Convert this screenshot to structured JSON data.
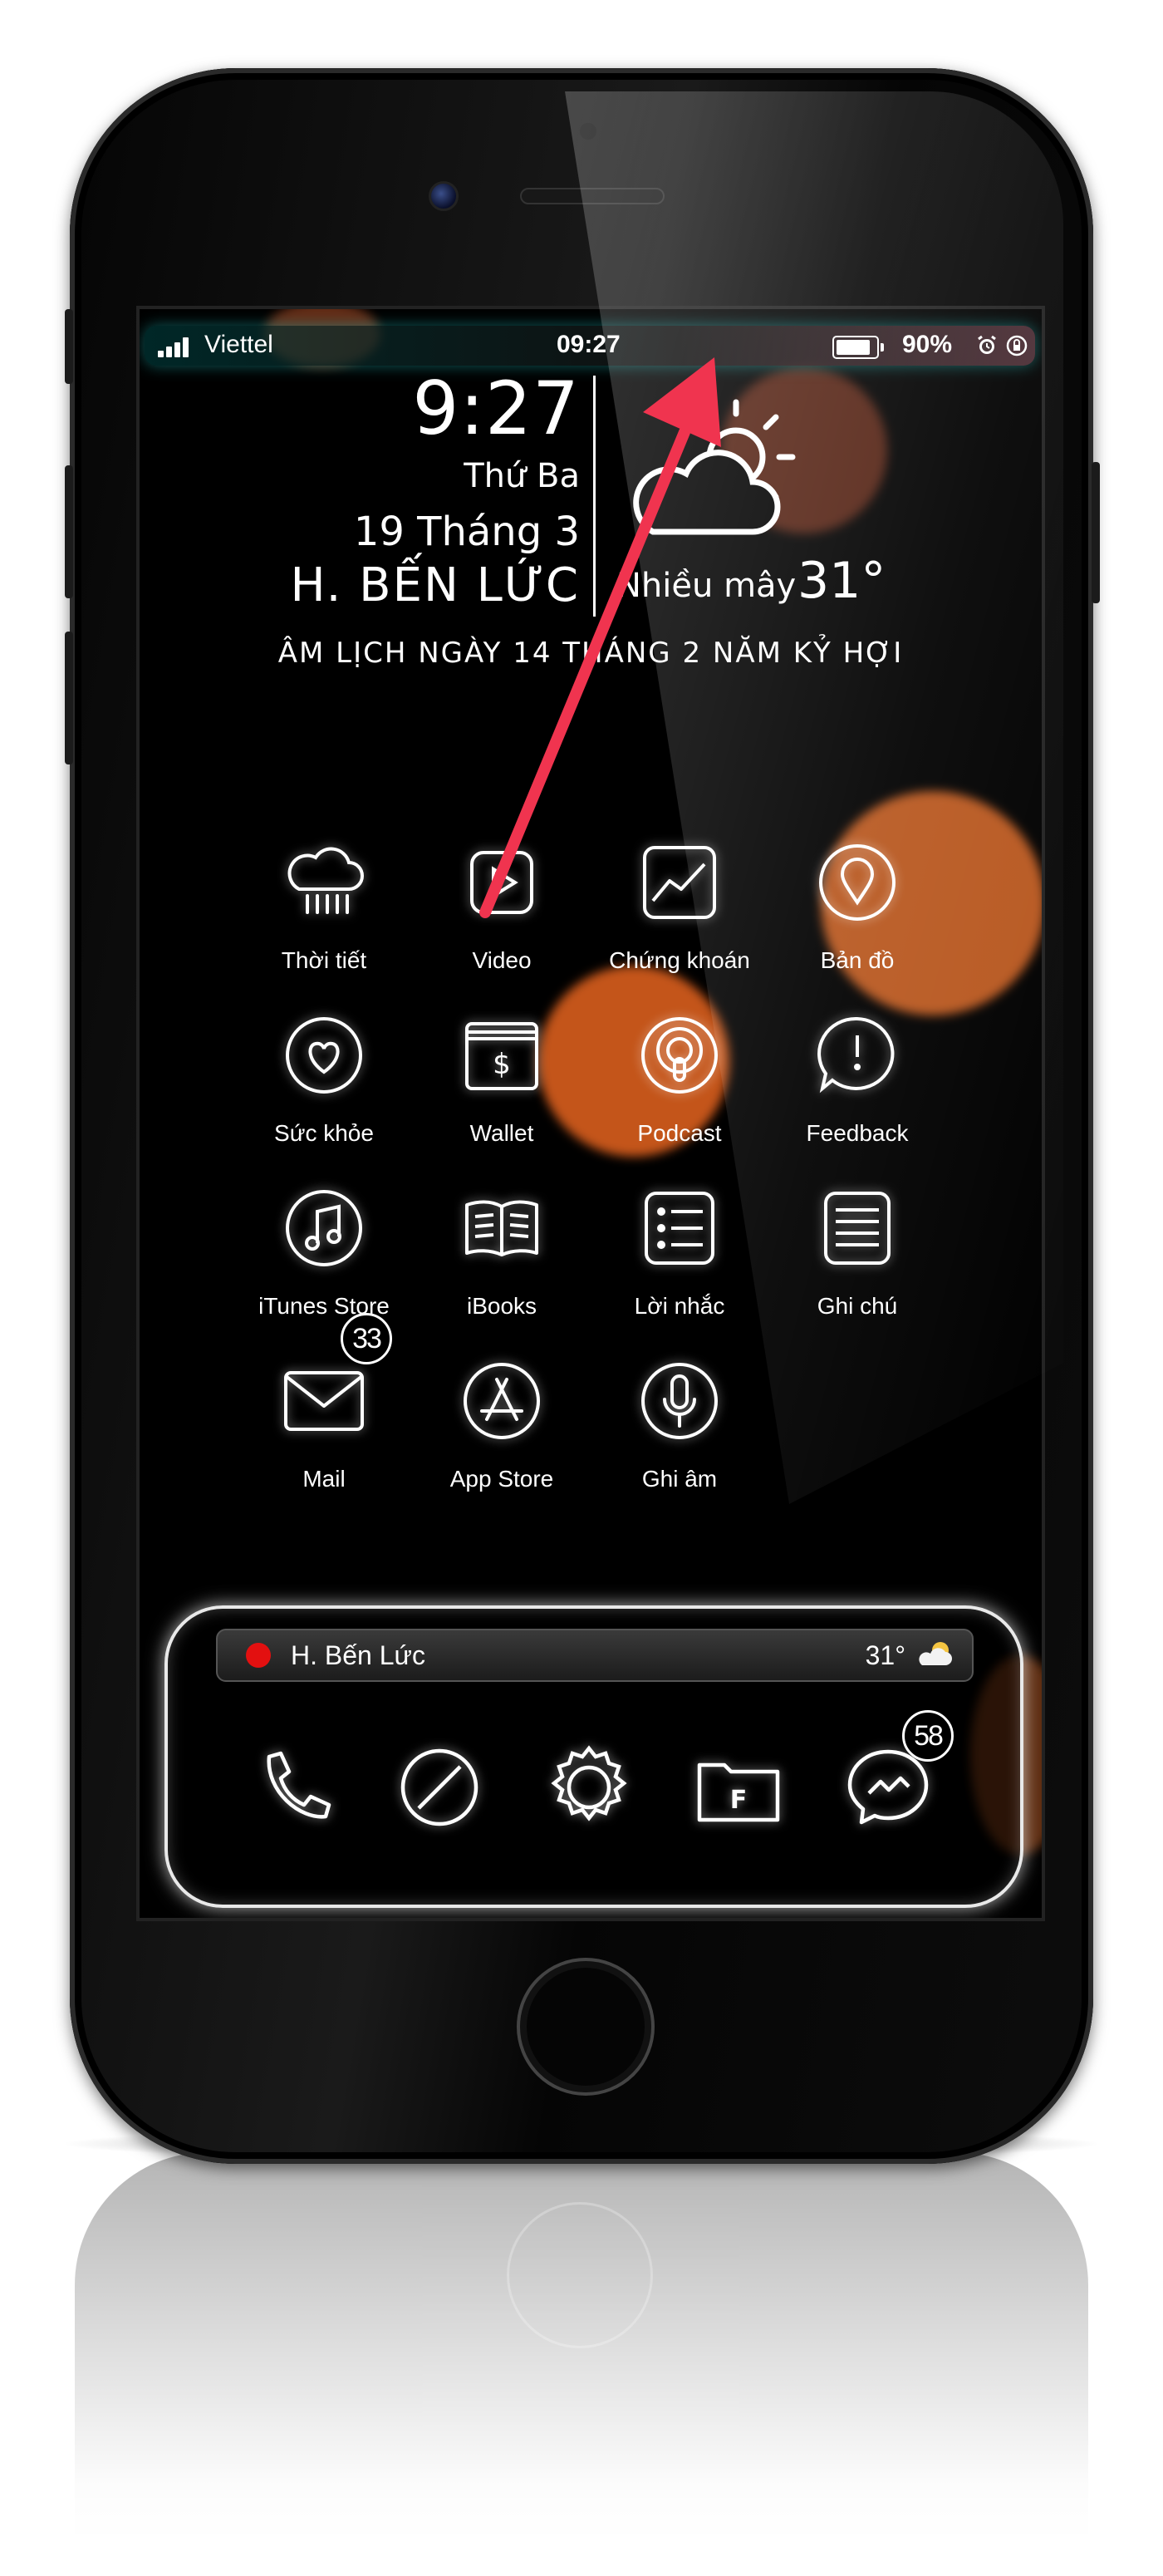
{
  "status_bar": {
    "carrier": "Viettel",
    "time": "09:27",
    "battery_percent": "90%",
    "battery_level": 0.9,
    "icons": [
      "signal-bars-icon",
      "battery-icon",
      "alarm-icon",
      "rotation-lock-icon"
    ]
  },
  "clock_widget": {
    "time": "9:27",
    "day_of_week": "Thứ Ba",
    "date": "19 Tháng 3",
    "location": "H. BẾN LỨC",
    "lunar_date": "ÂM LỊCH NGÀY 14 THÁNG 2 NĂM KỶ HỢI"
  },
  "weather_widget": {
    "icon": "partly-cloudy-icon",
    "description": "Nhiều mây",
    "temperature": "31°"
  },
  "apps": [
    {
      "label": "Thời tiết",
      "icon": "weather-rain-icon"
    },
    {
      "label": "Video",
      "icon": "video-play-icon"
    },
    {
      "label": "Chứng khoán",
      "icon": "stocks-chart-icon"
    },
    {
      "label": "Bản đồ",
      "icon": "map-pin-icon"
    },
    {
      "label": "Sức khỏe",
      "icon": "heart-icon"
    },
    {
      "label": "Wallet",
      "icon": "wallet-icon"
    },
    {
      "label": "Podcast",
      "icon": "podcast-icon"
    },
    {
      "label": "Feedback",
      "icon": "feedback-bubble-icon"
    },
    {
      "label": "iTunes Store",
      "icon": "music-note-icon"
    },
    {
      "label": "iBooks",
      "icon": "book-icon"
    },
    {
      "label": "Lời nhắc",
      "icon": "reminders-list-icon"
    },
    {
      "label": "Ghi chú",
      "icon": "notes-icon"
    },
    {
      "label": "Mail",
      "icon": "mail-envelope-icon",
      "badge": "33"
    },
    {
      "label": "App Store",
      "icon": "app-store-icon"
    },
    {
      "label": "Ghi âm",
      "icon": "microphone-icon"
    }
  ],
  "dock": {
    "widget_location": "H. Bến Lức",
    "widget_temperature": "31°",
    "widget_icon": "sun-cloud-icon",
    "apps": [
      {
        "icon": "phone-icon"
      },
      {
        "icon": "safari-compass-icon"
      },
      {
        "icon": "settings-gear-icon"
      },
      {
        "icon": "files-folder-icon",
        "glyph": "F"
      },
      {
        "icon": "messenger-icon",
        "badge": "58"
      }
    ]
  },
  "colors": {
    "annotation_arrow": "#f0344f",
    "widget_red_dot": "#e31010",
    "icon_stroke": "#ffffff"
  }
}
